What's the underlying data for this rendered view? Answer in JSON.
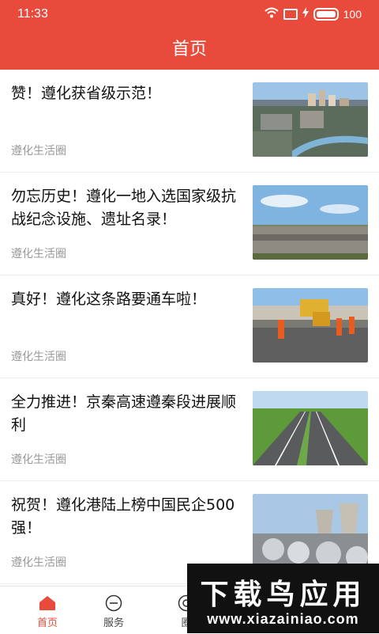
{
  "status_bar": {
    "time": "11:33",
    "battery": "100"
  },
  "header": {
    "title": "首页"
  },
  "articles": [
    {
      "title": "赞！遵化获省级示范！",
      "source": "遵化生活圈",
      "image": "city-river-aerial"
    },
    {
      "title": "勿忘历史！遵化一地入选国家级抗战纪念设施、遗址名录！",
      "source": "遵化生活圈",
      "image": "memorial-stone"
    },
    {
      "title": "真好！遵化这条路要通车啦！",
      "source": "遵化生活圈",
      "image": "road-construction"
    },
    {
      "title": "全力推进！京秦高速遵秦段进展顺利",
      "source": "遵化生活圈",
      "image": "highway"
    },
    {
      "title": "祝贺！遵化港陆上榜中国民企500强！",
      "source": "遵化生活圈",
      "image": "industrial-plant"
    }
  ],
  "tabs": [
    {
      "label": "首页",
      "icon": "home-icon",
      "active": true
    },
    {
      "label": "服务",
      "icon": "minus-circle-icon",
      "active": false
    },
    {
      "label": "圈",
      "icon": "circle-icon",
      "active": false
    }
  ],
  "watermark": {
    "big": "下载鸟应用",
    "small": "www.xiazainiao.com"
  },
  "colors": {
    "accent": "#e84a3b"
  }
}
